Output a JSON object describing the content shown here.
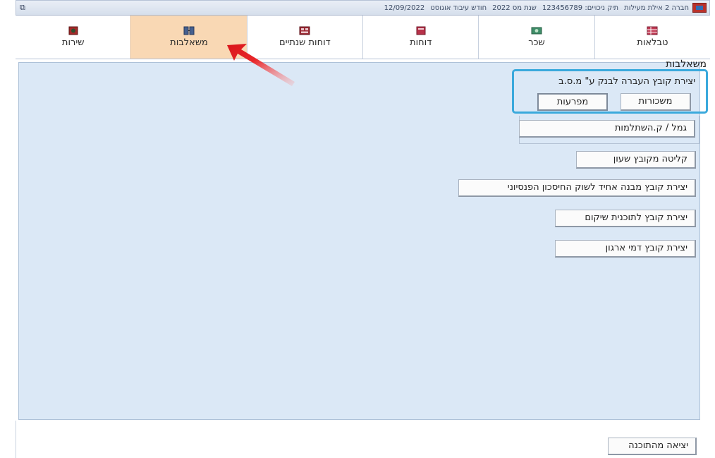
{
  "titlebar": {
    "company": "חברה 2 אילת מעילות",
    "tax_id": "תיק ניכויים: 123456789",
    "tax_year": "שנת מס 2022",
    "month": "חודש עיבוד אוגוסט",
    "date": "12/09/2022",
    "restore_glyph": "⧉"
  },
  "tabs": [
    {
      "label": "טבלאות",
      "icon": "tables-icon"
    },
    {
      "label": "שכר",
      "icon": "salary-icon"
    },
    {
      "label": "דוחות",
      "icon": "reports-icon"
    },
    {
      "label": "דוחות שנתיים",
      "icon": "annual-reports-icon"
    },
    {
      "label": "משאלבות",
      "icon": "interfaces-icon",
      "active": true
    },
    {
      "label": "שירות",
      "icon": "service-icon"
    }
  ],
  "section": {
    "title": "משאלבות"
  },
  "bank_group": {
    "label": "יצירת קובץ העברה לבנק ע\" מ.ס.ב",
    "salaries_button": "משכורות",
    "deductions_button": "מפרעות"
  },
  "buttons": {
    "pension": "גמל / ק.השתלמות",
    "clock_import": "קליטה מקובץ שעון",
    "pension_market_file": "יצירת קובץ מבנה אחיד לשוק החיסכון הפנסיוני",
    "rehab_file": "יצירת קובץ לתוכנית שיקום",
    "org_fees_file": "יצירת קובץ דמי ארגון",
    "exit": "יציאה מהתוכנה"
  },
  "colors": {
    "active_tab": "#f9d8b4",
    "panel": "#dbe8f6",
    "highlight": "#3aa9dc",
    "arrow": "#e8272a"
  }
}
